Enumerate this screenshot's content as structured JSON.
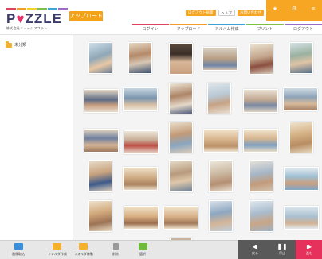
{
  "header": {
    "logo_text_prefix": "P",
    "logo_heart": "♥",
    "logo_text_suffix": "ZZLE",
    "logo_subtitle": "株式会社ミュージアフラト",
    "upload_button": "アップロード",
    "top_links": [
      "ログアウト画面",
      "ヘルプ",
      "お問い合わせ"
    ],
    "tabs": [
      {
        "label": "ログイン",
        "color": "#e0415f"
      },
      {
        "label": "アップロード",
        "color": "#f39c2a"
      },
      {
        "label": "アルバム作成",
        "color": "#3fa3d6"
      },
      {
        "label": "プリント",
        "color": "#7cc143"
      },
      {
        "label": "ログアウト",
        "color": "#9c6bc7"
      }
    ]
  },
  "sidebar": {
    "folder_label": "未分類"
  },
  "photos": [
    {
      "alt": "children drawing at table"
    },
    {
      "alt": "child at desk"
    },
    {
      "alt": "child close-up"
    },
    {
      "alt": "children at table"
    },
    {
      "alt": "child with book"
    },
    {
      "alt": "child portrait"
    },
    {
      "alt": "group at tables"
    },
    {
      "alt": "classroom"
    },
    {
      "alt": "child at desk"
    },
    {
      "alt": "child reading"
    },
    {
      "alt": "classroom group"
    },
    {
      "alt": "children with teacher"
    },
    {
      "alt": "children playing"
    },
    {
      "alt": "children with laptop"
    },
    {
      "alt": "teacher and child"
    },
    {
      "alt": "child portrait"
    },
    {
      "alt": "children in room"
    },
    {
      "alt": "bookshelf room"
    },
    {
      "alt": "child smiling"
    },
    {
      "alt": "library"
    },
    {
      "alt": "child standing"
    },
    {
      "alt": "children seated"
    },
    {
      "alt": "children in hall"
    },
    {
      "alt": "child in room"
    },
    {
      "alt": "children playing outside"
    },
    {
      "alt": "children at tables"
    },
    {
      "alt": "children in hall"
    },
    {
      "alt": "children on floor"
    },
    {
      "alt": "group photo"
    },
    {
      "alt": "children outside"
    },
    {
      "alt": "children running"
    },
    {
      "alt": "partial photo"
    }
  ],
  "toolbar": {
    "tools": [
      {
        "label": "画像取込",
        "color": "#3c8fd6"
      },
      {
        "label": "フォルダ作成",
        "color": "#f2b230"
      },
      {
        "label": "フォルダ移動",
        "color": "#f2b230"
      },
      {
        "label": "削除",
        "color": "#9a9a9a"
      },
      {
        "label": "選択",
        "color": "#6fba3b"
      }
    ],
    "nav": [
      {
        "glyph": "◀",
        "label": "戻る"
      },
      {
        "glyph": "❚❚",
        "label": "停止"
      },
      {
        "glyph": "▶",
        "label": "進む"
      }
    ]
  }
}
